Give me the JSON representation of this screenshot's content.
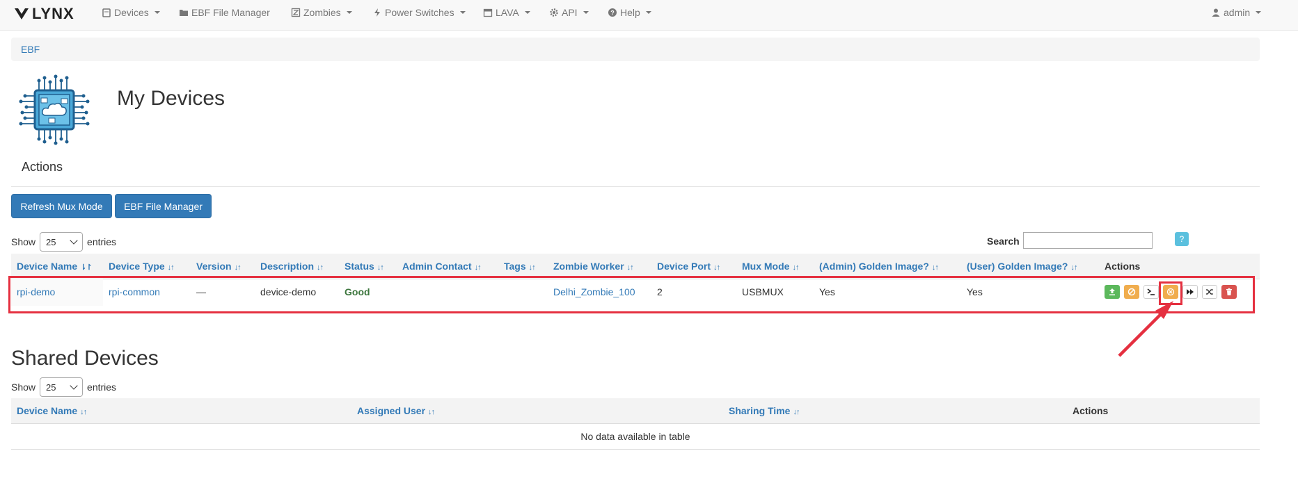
{
  "navbar": {
    "brand": "LYNX",
    "items": [
      {
        "label": "Devices",
        "icon": "device-icon",
        "dropdown": true
      },
      {
        "label": "EBF File Manager",
        "icon": "folder-icon",
        "dropdown": false
      },
      {
        "label": "Zombies",
        "icon": "zombie-icon",
        "dropdown": true
      },
      {
        "label": "Power Switches",
        "icon": "bolt-icon",
        "dropdown": true
      },
      {
        "label": "LAVA",
        "icon": "calendar-icon",
        "dropdown": true
      },
      {
        "label": "API",
        "icon": "gear-icon",
        "dropdown": true
      },
      {
        "label": "Help",
        "icon": "question-icon",
        "dropdown": true
      }
    ],
    "user": "admin"
  },
  "breadcrumb": "EBF",
  "page_title": "My Devices",
  "actions_title": "Actions",
  "buttons": {
    "refresh": "Refresh Mux Mode",
    "ebf": "EBF File Manager"
  },
  "my_devices": {
    "show_label": "Show",
    "entries_label": "entries",
    "page_length": "25",
    "search_label": "Search",
    "help": "?",
    "columns": [
      "Device Name",
      "Device Type",
      "Version",
      "Description",
      "Status",
      "Admin Contact",
      "Tags",
      "Zombie Worker",
      "Device Port",
      "Mux Mode",
      "(Admin) Golden Image?",
      "(User) Golden Image?",
      "Actions"
    ],
    "rows": [
      {
        "device_name": "rpi-demo",
        "device_type": "rpi-common",
        "version": "—",
        "description": "device-demo",
        "status": "Good",
        "admin_contact": "",
        "tags": "",
        "zombie_worker": "Delhi_Zombie_100",
        "device_port": "2",
        "mux_mode": "USBMUX",
        "admin_golden": "Yes",
        "user_golden": "Yes"
      }
    ],
    "action_colors": {
      "success": "#5cb85c",
      "warning": "#f0ad4e",
      "danger": "#d9534f"
    }
  },
  "shared_devices": {
    "title": "Shared Devices",
    "show_label": "Show",
    "entries_label": "entries",
    "page_length": "25",
    "columns": [
      "Device Name",
      "Assigned User",
      "Sharing Time",
      "Actions"
    ],
    "empty_message": "No data available in table"
  },
  "annotation_color": "#e53040"
}
